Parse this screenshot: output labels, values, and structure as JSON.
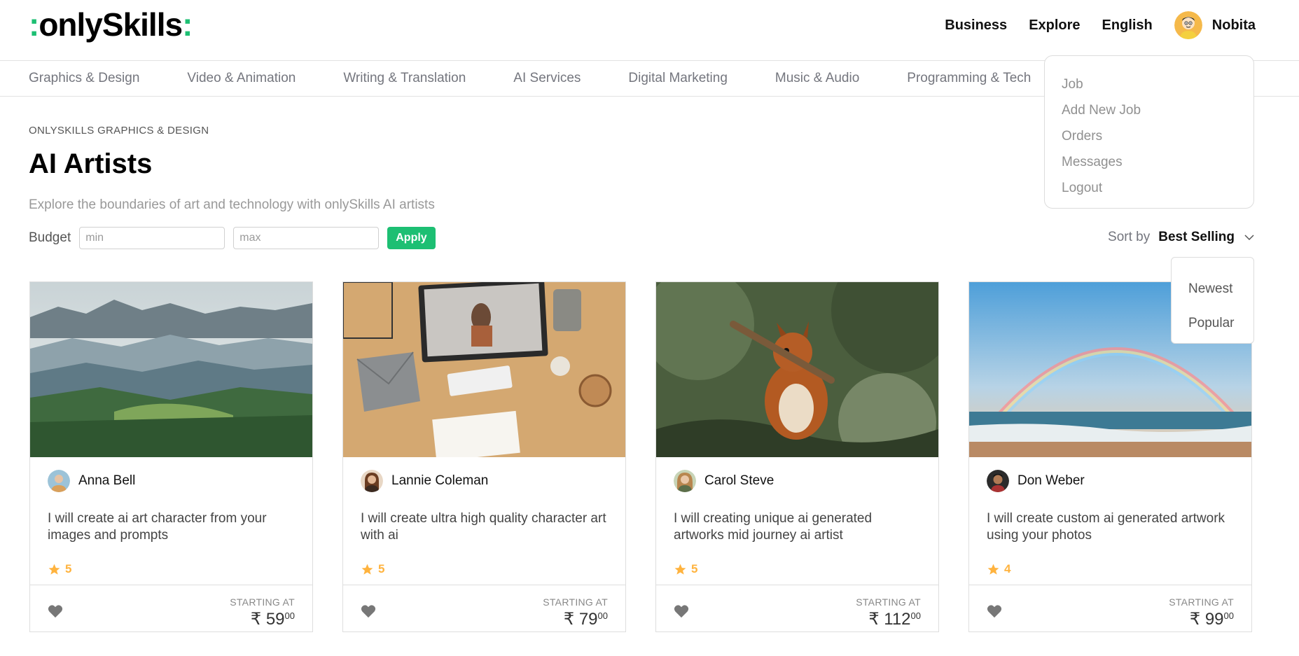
{
  "brand": {
    "prefix": ":",
    "name": "onlySkills",
    "suffix": ":",
    "accent": "#1dbf73"
  },
  "nav": {
    "business": "Business",
    "explore": "Explore",
    "language": "English",
    "user_name": "Nobita"
  },
  "categories": [
    "Graphics & Design",
    "Video & Animation",
    "Writing & Translation",
    "AI Services",
    "Digital Marketing",
    "Music & Audio",
    "Programming & Tech"
  ],
  "breadcrumb": "ONLYSKILLS GRAPHICS & DESIGN",
  "page": {
    "title": "AI Artists",
    "description": "Explore the boundaries of art and technology with onlySkills AI artists"
  },
  "filters": {
    "budget_label": "Budget",
    "min_placeholder": "min",
    "max_placeholder": "max",
    "apply_label": "Apply"
  },
  "sort": {
    "label": "Sort by",
    "selected": "Best Selling",
    "options": [
      "Newest",
      "Popular"
    ]
  },
  "user_menu": [
    "Job",
    "Add New Job",
    "Orders",
    "Messages",
    "Logout"
  ],
  "gigs": [
    {
      "seller": "Anna Bell",
      "description": "I will create ai art character from your images and prompts",
      "rating": "5",
      "starting_label": "STARTING AT",
      "currency": "₹",
      "price": "59",
      "price_cents": "00",
      "image": "misty-mountain-forest"
    },
    {
      "seller": "Lannie Coleman",
      "description": "I will create ultra high quality character art with ai",
      "rating": "5",
      "starting_label": "STARTING AT",
      "currency": "₹",
      "price": "79",
      "price_cents": "00",
      "image": "desk-with-monitor"
    },
    {
      "seller": "Carol Steve",
      "description": "I will creating unique ai generated artworks mid journey ai artist",
      "rating": "5",
      "starting_label": "STARTING AT",
      "currency": "₹",
      "price": "112",
      "price_cents": "00",
      "image": "squirrel-in-tree"
    },
    {
      "seller": "Don Weber",
      "description": "I will create custom ai generated artwork using your photos",
      "rating": "4",
      "starting_label": "STARTING AT",
      "currency": "₹",
      "price": "99",
      "price_cents": "00",
      "image": "rainbow-over-beach"
    }
  ],
  "colors": {
    "accent": "#1dbf73",
    "star": "#ffb33e",
    "heart": "#777777"
  }
}
